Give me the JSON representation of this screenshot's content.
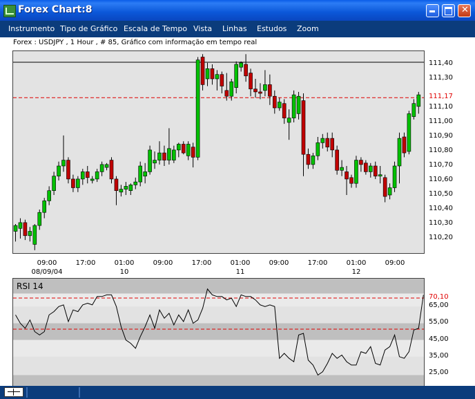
{
  "window": {
    "title": "Forex Chart:8"
  },
  "menu": [
    "Instrumento",
    "Tipo de Gráfico",
    "Escala de Tempo",
    "Vista",
    "Linhas",
    "Estudos",
    "Zoom"
  ],
  "chart_header": "Forex : USDJPY , 1 Hour , # 85, Gráfico com informação em tempo real",
  "chart_data": [
    {
      "type": "candlestick",
      "symbol": "USDJPY",
      "ylim": [
        110.12,
        111.48
      ],
      "yticks": [
        "111,40",
        "111,30",
        "111,17",
        "111,10",
        "111,00",
        "110,90",
        "110,80",
        "110,70",
        "110,60",
        "110,50",
        "110,40",
        "110,30",
        "110,20"
      ],
      "ytick_values": [
        111.4,
        111.3,
        111.17,
        111.1,
        111.0,
        110.9,
        110.8,
        110.7,
        110.6,
        110.5,
        110.4,
        110.3,
        110.2
      ],
      "current_price_label": "111,17",
      "current_price": 111.17,
      "xticks": [
        "09:00",
        "17:00",
        "01:00",
        "09:00",
        "17:00",
        "01:00",
        "09:00",
        "17:00",
        "01:00",
        "09:00"
      ],
      "date_labels": [
        "08/09/04",
        "10",
        "11",
        "12"
      ],
      "candles": [
        {
          "o": 110.25,
          "h": 110.3,
          "l": 110.18,
          "c": 110.29
        },
        {
          "o": 110.27,
          "h": 110.34,
          "l": 110.2,
          "c": 110.31
        },
        {
          "o": 110.31,
          "h": 110.33,
          "l": 110.19,
          "c": 110.22
        },
        {
          "o": 110.22,
          "h": 110.28,
          "l": 110.18,
          "c": 110.25
        },
        {
          "o": 110.16,
          "h": 110.3,
          "l": 110.12,
          "c": 110.29
        },
        {
          "o": 110.29,
          "h": 110.4,
          "l": 110.26,
          "c": 110.38
        },
        {
          "o": 110.38,
          "h": 110.48,
          "l": 110.34,
          "c": 110.46
        },
        {
          "o": 110.46,
          "h": 110.56,
          "l": 110.43,
          "c": 110.53
        },
        {
          "o": 110.53,
          "h": 110.66,
          "l": 110.5,
          "c": 110.63
        },
        {
          "o": 110.63,
          "h": 110.73,
          "l": 110.6,
          "c": 110.7
        },
        {
          "o": 110.7,
          "h": 110.91,
          "l": 110.66,
          "c": 110.74
        },
        {
          "o": 110.74,
          "h": 110.76,
          "l": 110.58,
          "c": 110.61
        },
        {
          "o": 110.61,
          "h": 110.64,
          "l": 110.52,
          "c": 110.55
        },
        {
          "o": 110.55,
          "h": 110.63,
          "l": 110.52,
          "c": 110.61
        },
        {
          "o": 110.61,
          "h": 110.68,
          "l": 110.57,
          "c": 110.66
        },
        {
          "o": 110.66,
          "h": 110.7,
          "l": 110.58,
          "c": 110.62
        },
        {
          "o": 110.6,
          "h": 110.63,
          "l": 110.58,
          "c": 110.61
        },
        {
          "o": 110.61,
          "h": 110.68,
          "l": 110.59,
          "c": 110.66
        },
        {
          "o": 110.66,
          "h": 110.73,
          "l": 110.63,
          "c": 110.71
        },
        {
          "o": 110.69,
          "h": 110.72,
          "l": 110.67,
          "c": 110.71
        },
        {
          "o": 110.74,
          "h": 110.76,
          "l": 110.58,
          "c": 110.61
        },
        {
          "o": 110.61,
          "h": 110.63,
          "l": 110.43,
          "c": 110.53
        },
        {
          "o": 110.52,
          "h": 110.57,
          "l": 110.49,
          "c": 110.54
        },
        {
          "o": 110.54,
          "h": 110.59,
          "l": 110.5,
          "c": 110.56
        },
        {
          "o": 110.53,
          "h": 110.58,
          "l": 110.5,
          "c": 110.57
        },
        {
          "o": 110.57,
          "h": 110.62,
          "l": 110.54,
          "c": 110.59
        },
        {
          "o": 110.59,
          "h": 110.73,
          "l": 110.56,
          "c": 110.7
        },
        {
          "o": 110.63,
          "h": 110.72,
          "l": 110.58,
          "c": 110.66
        },
        {
          "o": 110.66,
          "h": 110.84,
          "l": 110.64,
          "c": 110.81
        },
        {
          "o": 110.72,
          "h": 110.8,
          "l": 110.68,
          "c": 110.74
        },
        {
          "o": 110.74,
          "h": 110.87,
          "l": 110.71,
          "c": 110.79
        },
        {
          "o": 110.79,
          "h": 110.84,
          "l": 110.7,
          "c": 110.74
        },
        {
          "o": 110.74,
          "h": 110.96,
          "l": 110.71,
          "c": 110.82
        },
        {
          "o": 110.74,
          "h": 110.84,
          "l": 110.72,
          "c": 110.81
        },
        {
          "o": 110.81,
          "h": 110.86,
          "l": 110.76,
          "c": 110.85
        },
        {
          "o": 110.85,
          "h": 110.87,
          "l": 110.78,
          "c": 110.79
        },
        {
          "o": 110.77,
          "h": 110.87,
          "l": 110.74,
          "c": 110.85
        },
        {
          "o": 110.83,
          "h": 110.86,
          "l": 110.69,
          "c": 110.76
        },
        {
          "o": 110.76,
          "h": 111.45,
          "l": 110.74,
          "c": 111.43
        },
        {
          "o": 111.45,
          "h": 111.47,
          "l": 111.22,
          "c": 111.26
        },
        {
          "o": 111.3,
          "h": 111.41,
          "l": 111.25,
          "c": 111.37
        },
        {
          "o": 111.37,
          "h": 111.4,
          "l": 111.26,
          "c": 111.3
        },
        {
          "o": 111.3,
          "h": 111.36,
          "l": 111.22,
          "c": 111.33
        },
        {
          "o": 111.33,
          "h": 111.35,
          "l": 111.2,
          "c": 111.25
        },
        {
          "o": 111.22,
          "h": 111.34,
          "l": 111.15,
          "c": 111.18
        },
        {
          "o": 111.18,
          "h": 111.3,
          "l": 111.15,
          "c": 111.28
        },
        {
          "o": 111.24,
          "h": 111.42,
          "l": 111.2,
          "c": 111.4
        },
        {
          "o": 111.38,
          "h": 111.42,
          "l": 111.35,
          "c": 111.41
        },
        {
          "o": 111.4,
          "h": 111.47,
          "l": 111.28,
          "c": 111.32
        },
        {
          "o": 111.34,
          "h": 111.37,
          "l": 111.18,
          "c": 111.23
        },
        {
          "o": 111.23,
          "h": 111.3,
          "l": 111.17,
          "c": 111.21
        },
        {
          "o": 111.21,
          "h": 111.27,
          "l": 111.16,
          "c": 111.2
        },
        {
          "o": 111.22,
          "h": 111.36,
          "l": 111.18,
          "c": 111.26
        },
        {
          "o": 111.26,
          "h": 111.33,
          "l": 111.12,
          "c": 111.18
        },
        {
          "o": 111.18,
          "h": 111.22,
          "l": 111.06,
          "c": 111.1
        },
        {
          "o": 111.1,
          "h": 111.17,
          "l": 111.08,
          "c": 111.14
        },
        {
          "o": 111.13,
          "h": 111.16,
          "l": 110.99,
          "c": 111.03
        },
        {
          "o": 111.0,
          "h": 111.09,
          "l": 110.88,
          "c": 111.03
        },
        {
          "o": 111.03,
          "h": 111.22,
          "l": 111.0,
          "c": 111.19
        },
        {
          "o": 111.06,
          "h": 111.21,
          "l": 111.02,
          "c": 111.18
        },
        {
          "o": 111.15,
          "h": 111.2,
          "l": 110.63,
          "c": 110.78
        },
        {
          "o": 110.78,
          "h": 110.82,
          "l": 110.68,
          "c": 110.71
        },
        {
          "o": 110.71,
          "h": 110.79,
          "l": 110.68,
          "c": 110.77
        },
        {
          "o": 110.77,
          "h": 110.9,
          "l": 110.74,
          "c": 110.86
        },
        {
          "o": 110.86,
          "h": 110.92,
          "l": 110.82,
          "c": 110.89
        },
        {
          "o": 110.89,
          "h": 110.93,
          "l": 110.8,
          "c": 110.83
        },
        {
          "o": 110.89,
          "h": 110.93,
          "l": 110.76,
          "c": 110.81
        },
        {
          "o": 110.81,
          "h": 110.84,
          "l": 110.64,
          "c": 110.67
        },
        {
          "o": 110.67,
          "h": 110.74,
          "l": 110.63,
          "c": 110.69
        },
        {
          "o": 110.66,
          "h": 110.7,
          "l": 110.5,
          "c": 110.61
        },
        {
          "o": 110.62,
          "h": 110.64,
          "l": 110.55,
          "c": 110.58
        },
        {
          "o": 110.58,
          "h": 110.77,
          "l": 110.55,
          "c": 110.74
        },
        {
          "o": 110.74,
          "h": 110.76,
          "l": 110.66,
          "c": 110.71
        },
        {
          "o": 110.72,
          "h": 110.74,
          "l": 110.64,
          "c": 110.66
        },
        {
          "o": 110.66,
          "h": 110.72,
          "l": 110.62,
          "c": 110.7
        },
        {
          "o": 110.7,
          "h": 110.73,
          "l": 110.61,
          "c": 110.63
        },
        {
          "o": 110.63,
          "h": 110.7,
          "l": 110.58,
          "c": 110.64
        },
        {
          "o": 110.62,
          "h": 110.64,
          "l": 110.45,
          "c": 110.49
        },
        {
          "o": 110.5,
          "h": 110.58,
          "l": 110.47,
          "c": 110.55
        },
        {
          "o": 110.55,
          "h": 110.73,
          "l": 110.52,
          "c": 110.7
        },
        {
          "o": 110.7,
          "h": 110.93,
          "l": 110.58,
          "c": 110.89
        },
        {
          "o": 110.9,
          "h": 110.93,
          "l": 110.76,
          "c": 110.79
        },
        {
          "o": 110.8,
          "h": 111.08,
          "l": 110.78,
          "c": 111.06
        },
        {
          "o": 111.04,
          "h": 111.16,
          "l": 111.02,
          "c": 111.13
        },
        {
          "o": 111.11,
          "h": 111.21,
          "l": 111.06,
          "c": 111.19
        }
      ]
    },
    {
      "type": "line",
      "title": "RSI 14",
      "ylim": [
        20,
        76
      ],
      "yticks": [
        "70,10",
        "65,00",
        "55,00",
        "45,00",
        "35,00",
        "25,00"
      ],
      "ytick_values": [
        70.1,
        65.0,
        55.0,
        45.0,
        35.0,
        25.0
      ],
      "reference_lines": [
        70.1,
        51.5
      ],
      "values": [
        60,
        55,
        52,
        57,
        50,
        48,
        50,
        60,
        62,
        65,
        66,
        56,
        63,
        62,
        66,
        67,
        66,
        71,
        71,
        72,
        72,
        65,
        53,
        45,
        43,
        40,
        47,
        53,
        60,
        52,
        63,
        58,
        61,
        54,
        60,
        56,
        63,
        55,
        57,
        64,
        76,
        72,
        71,
        71,
        69,
        70,
        65,
        72,
        71,
        71,
        69,
        66,
        65,
        66,
        65,
        34,
        37,
        34,
        32,
        48,
        49,
        33,
        30,
        24,
        26,
        31,
        37,
        34,
        36,
        32,
        30,
        30,
        38,
        37,
        41,
        31,
        30,
        39,
        41,
        48,
        35,
        34,
        38,
        51,
        52,
        72
      ]
    }
  ],
  "colors": {
    "up": "#00C000",
    "down": "#C00000",
    "rsi_line": "#000000",
    "ref_line": "#FF0000",
    "menubar": "#0B3C7C"
  }
}
